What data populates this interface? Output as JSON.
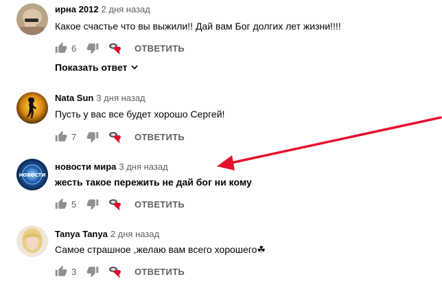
{
  "comments": [
    {
      "author": "ирна 2012",
      "time": "2 дня назад",
      "text": "Какое счастье что вы выжили!! Дай вам Бог долгих лет жизни!!!!",
      "likes": "6",
      "reply": "ОТВЕТИТЬ",
      "show_replies": "Показать ответ"
    },
    {
      "author": "Nata Sun",
      "time": "3 дня назад",
      "text": "Пусть у вас все будет хорошо Сергей!",
      "likes": "7",
      "reply": "ОТВЕТИТЬ"
    },
    {
      "author": "новости мира",
      "time": "3 дня назад",
      "text": "жесть такое пережить не дай бог ни кому",
      "likes": "5",
      "reply": "ОТВЕТИТЬ",
      "avatar_text": "НОВОСТИ"
    },
    {
      "author": "Tanya Tanya",
      "time": "2 дня назад",
      "text": "Самое страшное ,желаю вам всего хорошего☘",
      "likes": "3",
      "reply": "ОТВЕТИТЬ"
    }
  ],
  "colors": {
    "text": "#030303",
    "secondary": "#606060",
    "heart": "#e8002b",
    "annotation_arrow": "#e5102b"
  }
}
